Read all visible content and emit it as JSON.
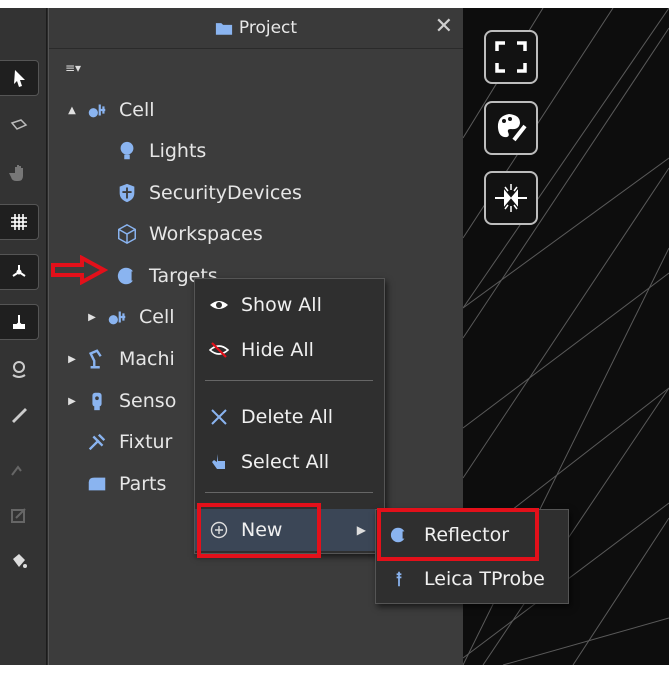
{
  "panel": {
    "title": "Project",
    "close_glyph": "✕",
    "tree_menu_glyph": "≡▾"
  },
  "tree": [
    {
      "label": "Cell",
      "icon": "cell-icon",
      "expander": "▲"
    },
    {
      "label": "Lights",
      "icon": "lightbulb-icon",
      "expander": ""
    },
    {
      "label": "SecurityDevices",
      "icon": "shield-icon",
      "expander": ""
    },
    {
      "label": "Workspaces",
      "icon": "cube-icon",
      "expander": ""
    },
    {
      "label": "Targets",
      "icon": "target-icon",
      "expander": ""
    },
    {
      "label": "Cell",
      "icon": "cell-icon",
      "expander": "▶"
    },
    {
      "label": "Machi",
      "icon": "robot-arm-icon",
      "expander": "▶"
    },
    {
      "label": "Senso",
      "icon": "sensor-icon",
      "expander": "▶"
    },
    {
      "label": "Fixtur",
      "icon": "fixture-icon",
      "expander": ""
    },
    {
      "label": "Parts",
      "icon": "part-icon",
      "expander": ""
    }
  ],
  "context_menu": {
    "items": [
      {
        "label": "Show All",
        "icon": "eye-icon"
      },
      {
        "label": "Hide All",
        "icon": "eye-hidden-icon"
      },
      {
        "label": "Delete All",
        "icon": "close-icon"
      },
      {
        "label": "Select All",
        "icon": "pointer-icon"
      },
      {
        "label": "New",
        "icon": "plus-circle-icon"
      }
    ],
    "submenu_arrow": "▶"
  },
  "submenu": {
    "items": [
      {
        "label": "Reflector",
        "icon": "reflector-icon"
      },
      {
        "label": "Leica TProbe",
        "icon": "probe-icon"
      }
    ]
  },
  "colors": {
    "accent_blue": "#8ab4f0",
    "highlight_red": "#e3101a",
    "panel_bg": "#3c3c3c",
    "menu_bg": "#2f2f2f",
    "viewport_bg": "#0d0d0d"
  }
}
